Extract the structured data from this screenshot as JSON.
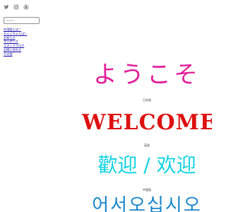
{
  "social": {
    "icons": [
      "twitter-icon",
      "instagram-icon",
      "snapchat-icon"
    ]
  },
  "search": {
    "placeholder": "Search",
    "value": ""
  },
  "nav": {
    "items": [
      "外国語とは？",
      "ちゃいちゃとは？",
      "お知らせ",
      "ランキング",
      "スタッフブログ",
      "お問い合わせ",
      "その他"
    ]
  },
  "greetings": [
    {
      "text": "ようこそ",
      "caption": "日本語",
      "color": "#e0209a"
    },
    {
      "text": "WELCOME",
      "caption": "英語",
      "color": "#dd1111"
    },
    {
      "text": "歡迎 / 欢迎",
      "caption": "中国語",
      "color": "#12d3e2"
    },
    {
      "text": "어서오십시오",
      "caption": "",
      "color": "#1a86c9"
    }
  ],
  "colors": {
    "link": "#1a0dab",
    "background": "#ffffff"
  }
}
